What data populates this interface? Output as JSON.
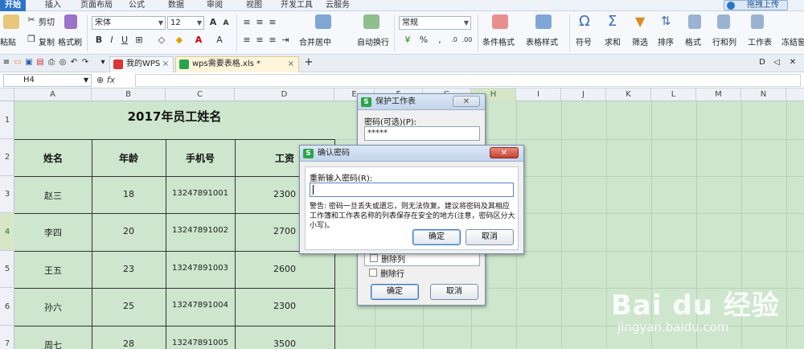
{
  "menubar": {
    "tabs": [
      "开始",
      "插入",
      "页面布局",
      "公式",
      "数据",
      "审阅",
      "视图",
      "开发工具",
      "云服务"
    ],
    "upload_label": "拖拽上传"
  },
  "ribbon": {
    "paste_label": "粘贴",
    "cut_label": "剪切",
    "copy_label": "复制",
    "format_painter_label": "格式刷",
    "font_name": "宋体",
    "font_size": "12",
    "merge_label": "合并居中",
    "wrap_label": "自动换行",
    "number_format": "常规",
    "cond_format_label": "条件格式",
    "table_style_label": "表格样式",
    "symbol_label": "符号",
    "sum_label": "求和",
    "filter_label": "筛选",
    "sort_label": "排序",
    "format_label": "格式",
    "rowcol_label": "行和列",
    "worksheet_label": "工作表",
    "freeze_label": "冻结窗"
  },
  "tabs": {
    "items": [
      {
        "label": "我的WPS",
        "close": "×"
      },
      {
        "label": "wps需要表格.xls *",
        "close": "×"
      }
    ],
    "add": "+"
  },
  "formula_bar": {
    "cell_ref": "H4",
    "fx": "fx"
  },
  "sheet": {
    "columns": [
      "A",
      "B",
      "C",
      "D",
      "E",
      "F",
      "G",
      "H",
      "I",
      "J",
      "K",
      "L",
      "M",
      "N"
    ],
    "rows": [
      "1",
      "2",
      "3",
      "4",
      "5",
      "6",
      "7"
    ],
    "title": "2017年员工姓名",
    "headers": [
      "姓名",
      "年龄",
      "手机号",
      "工资"
    ],
    "records": [
      {
        "name": "赵三",
        "age": "18",
        "phone": "13247891001",
        "salary": "2300"
      },
      {
        "name": "李四",
        "age": "20",
        "phone": "13247891002",
        "salary": "2700"
      },
      {
        "name": "王五",
        "age": "23",
        "phone": "13247891003",
        "salary": "2600"
      },
      {
        "name": "孙六",
        "age": "25",
        "phone": "13247891004",
        "salary": "2300"
      },
      {
        "name": "周七",
        "age": "28",
        "phone": "13247891005",
        "salary": "3500"
      }
    ]
  },
  "protect_dialog": {
    "title": "保护工作表",
    "password_label": "密码(可选)(P):",
    "password_value": "*****",
    "options": [
      "删除列",
      "删除行"
    ],
    "ok": "确定",
    "cancel": "取消"
  },
  "confirm_dialog": {
    "title": "确认密码",
    "label": "重新输入密码(R):",
    "warning": "警告: 密码一旦丢失或遗忘，则无法恢复。建议将密码及其相应工作簿和工作表名称的列表保存在安全的地方(注意，密码区分大小写)。",
    "ok": "确定",
    "cancel": "取消"
  },
  "watermark": {
    "logo": "Bai du 经验",
    "url": "jingyan.baidu.com"
  }
}
